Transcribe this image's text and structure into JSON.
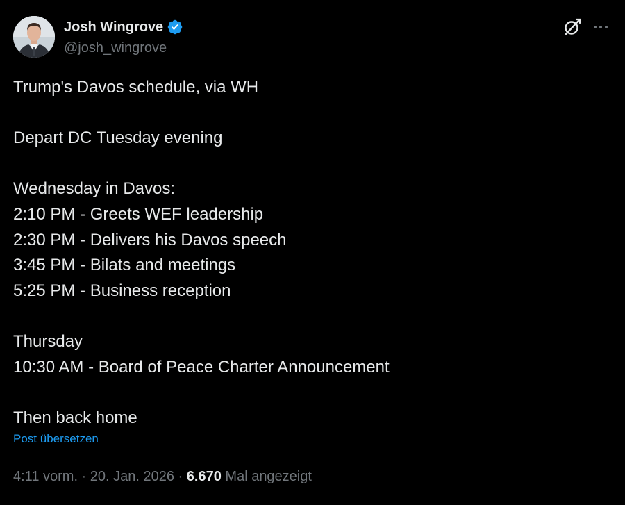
{
  "author": {
    "display_name": "Josh Wingrove",
    "handle": "@josh_wingrove",
    "verified": true,
    "verified_icon": "verified-badge",
    "avatar_icon": "profile-photo"
  },
  "header_actions": {
    "grok_icon": "grok-icon",
    "more_icon": "more-options-icon"
  },
  "tweet": {
    "lines": [
      "Trump's Davos schedule, via WH",
      "",
      "Depart DC Tuesday evening",
      "",
      "Wednesday in Davos:",
      "2:10 PM - Greets WEF leadership",
      "2:30 PM - Delivers his Davos speech",
      "3:45 PM - Bilats and meetings",
      "5:25 PM - Business reception",
      "",
      "Thursday",
      "10:30 AM - Board of Peace Charter Announcement",
      "",
      "Then back home"
    ],
    "translate_label": "Post übersetzen"
  },
  "meta": {
    "time": "4:11 vorm.",
    "separator": " · ",
    "date": "20. Jan. 2026",
    "views_count": "6.670",
    "views_label": "Mal angezeigt"
  },
  "colors": {
    "background": "#000000",
    "primary_text": "#e7e9ea",
    "secondary_text": "#71767b",
    "link": "#1d9bf0",
    "verified": "#1d9bf0"
  }
}
